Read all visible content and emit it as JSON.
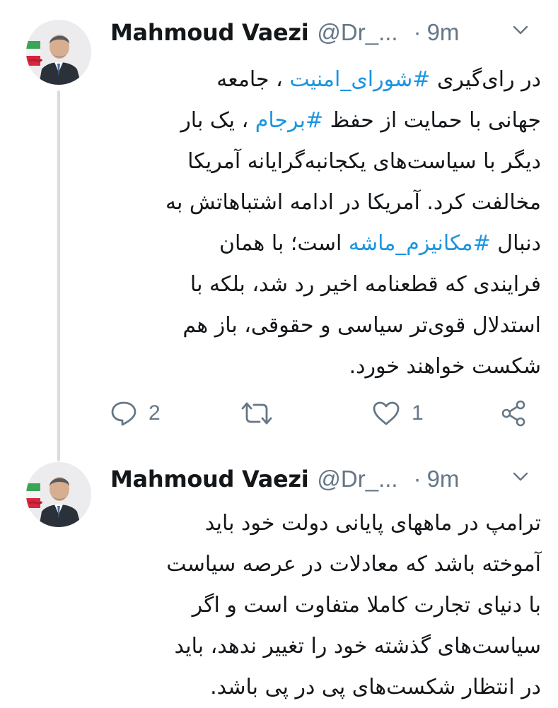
{
  "tweets": [
    {
      "display_name": "Mahmoud Vaezi",
      "handle": "@Dr_...",
      "dot": "·",
      "time": "9m",
      "lines": [
        [
          "در رای‌گیری ",
          {
            "hashtag": "#شورای_امنیت"
          },
          " ، جامعه"
        ],
        [
          "جهانی با حمایت از حفظ ",
          {
            "hashtag": "#برجام"
          },
          " ، یک بار"
        ],
        [
          "دیگر با سیاست‌های یکجانبه‌گرایانه آمریکا"
        ],
        [
          "مخالفت کرد. آمریکا در ادامه اشتباهاتش به"
        ],
        [
          "دنبال ",
          {
            "hashtag": "#مکانیزم_ماشه"
          },
          " است؛ با همان"
        ],
        [
          "فرایندی که قطعنامه اخیر رد شد، بلکه با"
        ],
        [
          "استدلال قوی‌تر سیاسی و حقوقی، باز هم"
        ],
        [
          "شکست خواهند خورد."
        ]
      ],
      "actions": {
        "reply_icon": "speech-bubble-icon",
        "reply_count": "2",
        "retweet_icon": "retweet-arrows-icon",
        "like_icon": "heart-icon",
        "like_count": "1",
        "share_icon": "share-nodes-icon"
      }
    },
    {
      "display_name": "Mahmoud Vaezi",
      "handle": "@Dr_...",
      "dot": "·",
      "time": "9m",
      "lines": [
        [
          "ترامپ در ماههای پایانی دولت خود باید"
        ],
        [
          "آموخته باشد که معادلات در عرصه سیاست"
        ],
        [
          "با دنیای تجارت کاملا متفاوت است و اگر"
        ],
        [
          "سیاست‌های گذشته خود را تغییر ندهد، باید"
        ],
        [
          "در انتظار شکست‌های پی در پی باشد."
        ]
      ]
    }
  ],
  "colors": {
    "text": "#14171a",
    "secondary": "#657786",
    "hashtag": "#1b95e0",
    "thread_line": "#d9dde1"
  }
}
